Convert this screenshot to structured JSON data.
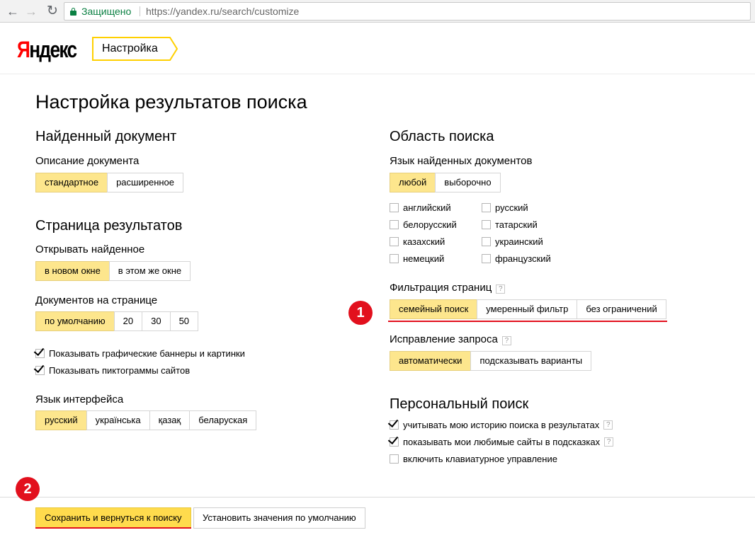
{
  "browser": {
    "secure_label": "Защищено",
    "url": "https://yandex.ru/search/customize"
  },
  "header": {
    "logo_first": "Я",
    "logo_rest": "ндекс",
    "crumb": "Настройка"
  },
  "page_title": "Настройка результатов поиска",
  "found_document": {
    "title": "Найденный документ",
    "description_label": "Описание документа",
    "options": [
      "стандартное",
      "расширенное"
    ],
    "selected": "стандартное"
  },
  "results_page": {
    "title": "Страница результатов",
    "open_label": "Открывать найденное",
    "open_options": [
      "в новом окне",
      "в этом же окне"
    ],
    "docs_label": "Документов на странице",
    "docs_options": [
      "по умолчанию",
      "20",
      "30",
      "50"
    ],
    "checkbox_banners": "Показывать графические баннеры и картинки",
    "checkbox_banners_checked": true,
    "checkbox_icons": "Показывать пиктограммы сайтов",
    "checkbox_icons_checked": true
  },
  "interface_language": {
    "label": "Язык интерфейса",
    "options": [
      "русский",
      "українська",
      "қазақ",
      "беларуская"
    ]
  },
  "search_area": {
    "title": "Область поиска",
    "lang_label": "Язык найденных документов",
    "lang_options": [
      "любой",
      "выборочно"
    ],
    "languages": [
      "английский",
      "русский",
      "белорусский",
      "татарский",
      "казахский",
      "украинский",
      "немецкий",
      "французский"
    ]
  },
  "filtering": {
    "label": "Фильтрация страниц",
    "options": [
      "семейный поиск",
      "умеренный фильтр",
      "без ограничений"
    ]
  },
  "correction": {
    "label": "Исправление запроса",
    "options": [
      "автоматически",
      "подсказывать варианты"
    ]
  },
  "personal": {
    "title": "Персональный поиск",
    "history": "учитывать мою историю поиска в результатах",
    "history_checked": true,
    "favorites": "показывать мои любимые сайты в подсказках",
    "favorites_checked": true,
    "keyboard": "включить клавиатурное управление",
    "keyboard_checked": false
  },
  "footer": {
    "save": "Сохранить и вернуться к поиску",
    "defaults": "Установить значения по умолчанию"
  },
  "help_glyph": "?",
  "annotations": {
    "marker_1": "1",
    "marker_2": "2",
    "color": "#e2101d"
  },
  "colors": {
    "active_option": "#fde68d",
    "primary_button": "#ffdb4d",
    "secure": "#0b8043",
    "logo_red": "#ff0000"
  }
}
